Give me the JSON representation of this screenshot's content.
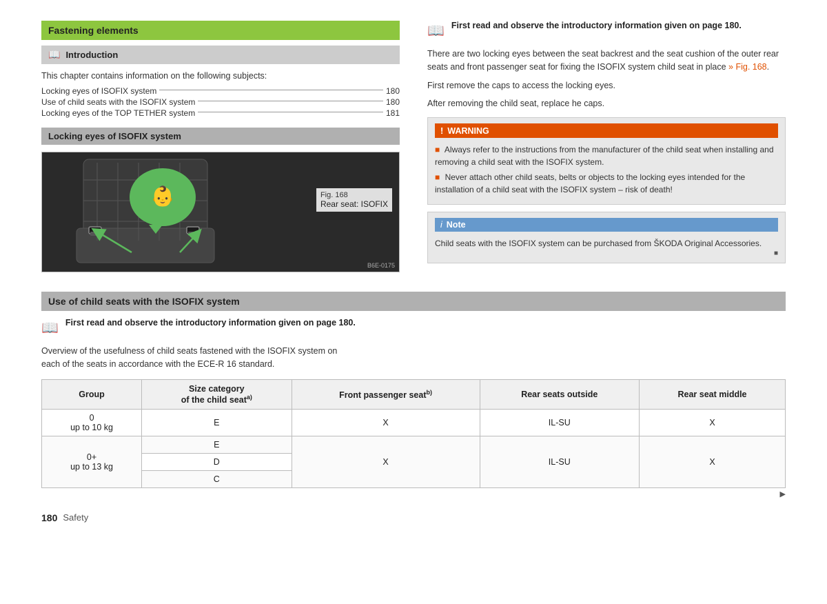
{
  "page": {
    "number": "180",
    "section": "Safety"
  },
  "fastening_elements": {
    "title": "Fastening elements"
  },
  "introduction": {
    "header": "Introduction",
    "book_icon": "📖",
    "intro_text": "This chapter contains information on the following subjects:",
    "toc_items": [
      {
        "label": "Locking eyes of ISOFIX system",
        "page": "180"
      },
      {
        "label": "Use of child seats with the ISOFIX system",
        "page": "180"
      },
      {
        "label": "Locking eyes of the TOP TETHER system",
        "page": "181"
      }
    ]
  },
  "locking_eyes": {
    "header": "Locking eyes of ISOFIX system",
    "fig_title": "Fig. 168",
    "fig_caption": "Rear seat: ISOFIX",
    "watermark": "B6E-0175"
  },
  "use_of_child_seats": {
    "header": "Use of child seats with the ISOFIX system",
    "read_note_text": "First read and observe the introductory information given on page 180.",
    "overview_text_1": "Overview of the usefulness of child seats fastened with the ISOFIX system on",
    "overview_text_2": "each of the seats in accordance with the ECE-R 16 standard.",
    "table": {
      "headers": [
        "Group",
        "Size category\nof the child seat",
        "Front passenger seat",
        "Rear seats outside",
        "Rear seat middle"
      ],
      "header_superscripts": [
        "",
        "a)",
        "b)",
        "",
        ""
      ],
      "rows": [
        {
          "group": "0\nup to 10 kg",
          "size": "E",
          "front": "X",
          "rear_outside": "IL-SU",
          "rear_middle": "X",
          "rowspan": 1
        },
        {
          "group": "0+\nup to 13 kg",
          "size_rows": [
            "E",
            "D",
            "C"
          ],
          "front": "X",
          "rear_outside": "IL-SU",
          "rear_middle": "X",
          "rowspan": 3
        }
      ]
    }
  },
  "right_column": {
    "read_note_text": "First read and observe the introductory information given on page 180.",
    "body1": "There are two locking eyes between the seat backrest and the seat cushion of the outer rear seats and front passenger seat for fixing the ISOFIX system child seat in place",
    "fig_ref": "» Fig. 168",
    "body2": "First remove the caps to access the locking eyes.",
    "body3": "After removing the child seat, replace he caps.",
    "warning": {
      "title": "WARNING",
      "lines": [
        "Always refer to the instructions from the manufacturer of the child seat when installing and removing a child seat with the ISOFIX system.",
        "Never attach other child seats, belts or objects to the locking eyes intended for the installation of a child seat with the ISOFIX system – risk of death!"
      ]
    },
    "note": {
      "title": "Note",
      "text": "Child seats with the ISOFIX system can be purchased from ŠKODA Original Accessories."
    }
  }
}
